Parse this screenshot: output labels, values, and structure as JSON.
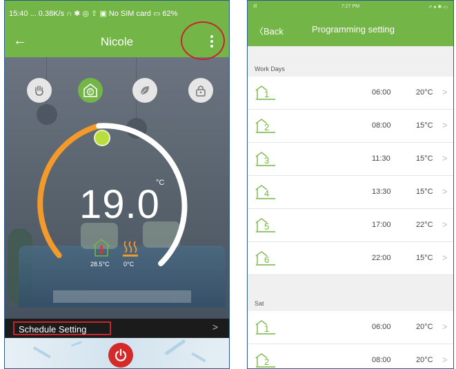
{
  "left": {
    "status_text": "15:40 ... 0.38K/s ∩ ✱ ◎ ⇧ ▣ No SIM card ▭ 62%",
    "nav": {
      "title": "Nicole",
      "back_icon": "back-arrow-icon",
      "menu_icon": "more-vertical-icon"
    },
    "modes": [
      {
        "name": "manual-hand-icon",
        "active": false
      },
      {
        "name": "program-mode-icon",
        "active": true
      },
      {
        "name": "eco-leaf-icon",
        "active": false
      },
      {
        "name": "lock-icon",
        "active": false
      }
    ],
    "setpoint": "19.0",
    "unit": "°C",
    "room_temp": "28.5°C",
    "floor_temp": "0°C",
    "schedule_label": "Schedule Setting",
    "chevron": ">",
    "colors": {
      "green": "#74b547",
      "arc_orange": "#f39a2b",
      "highlight": "#c8242c",
      "power": "#d42a2a"
    }
  },
  "right": {
    "status": {
      "signal": "ıll",
      "time": "7:27 PM",
      "battery": "➚ ● ✱ ▭"
    },
    "nav": {
      "back": "〈Back",
      "title": "Programming setting"
    },
    "sections": [
      {
        "title": "Work Days",
        "rows": [
          {
            "period": "1",
            "time": "06:00",
            "temp": "20°C"
          },
          {
            "period": "2",
            "time": "08:00",
            "temp": "15°C"
          },
          {
            "period": "3",
            "time": "11:30",
            "temp": "15°C"
          },
          {
            "period": "4",
            "time": "13:30",
            "temp": "15°C"
          },
          {
            "period": "5",
            "time": "17:00",
            "temp": "22°C"
          },
          {
            "period": "6",
            "time": "22:00",
            "temp": "15°C"
          }
        ]
      },
      {
        "title": "Sat",
        "rows": [
          {
            "period": "1",
            "time": "06:00",
            "temp": "20°C"
          },
          {
            "period": "2",
            "time": "08:00",
            "temp": "20°C"
          }
        ]
      }
    ],
    "chevron": ">"
  }
}
